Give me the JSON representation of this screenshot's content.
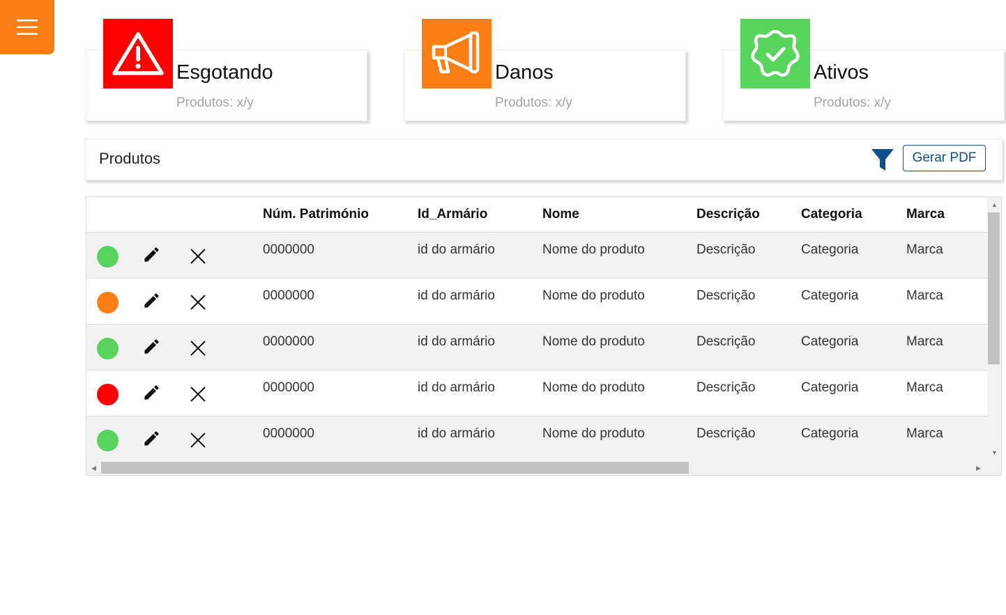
{
  "menu": {
    "icon": "hamburger-icon"
  },
  "cards": [
    {
      "title": "Esgotando",
      "subtitle": "Produtos: x/y",
      "icon": "warning-triangle-icon",
      "color": "#ff0000"
    },
    {
      "title": "Danos",
      "subtitle": "Produtos: x/y",
      "icon": "megaphone-icon",
      "color": "#fd7e14"
    },
    {
      "title": "Ativos",
      "subtitle": "Produtos: x/y",
      "icon": "verified-badge-icon",
      "color": "#56d45b"
    }
  ],
  "products": {
    "title": "Produtos",
    "filter_icon": "filter-funnel-icon",
    "pdf_button": "Gerar PDF"
  },
  "table": {
    "columns": [
      "Núm. Património",
      "Id_Armário",
      "Nome",
      "Descrição",
      "Categoria",
      "Marca"
    ],
    "rows": [
      {
        "status": "#56d45b",
        "num": "0000000",
        "armario": "id do armário",
        "nome": "Nome do produto",
        "descricao": "Descrição",
        "categoria": "Categoria",
        "marca": "Marca"
      },
      {
        "status": "#fd7e14",
        "num": "0000000",
        "armario": "id do armário",
        "nome": "Nome do produto",
        "descricao": "Descrição",
        "categoria": "Categoria",
        "marca": "Marca"
      },
      {
        "status": "#56d45b",
        "num": "0000000",
        "armario": "id do armário",
        "nome": "Nome do produto",
        "descricao": "Descrição",
        "categoria": "Categoria",
        "marca": "Marca"
      },
      {
        "status": "#ff0000",
        "num": "0000000",
        "armario": "id do armário",
        "nome": "Nome do produto",
        "descricao": "Descrição",
        "categoria": "Categoria",
        "marca": "Marca"
      },
      {
        "status": "#56d45b",
        "num": "0000000",
        "armario": "id do armário",
        "nome": "Nome do produto",
        "descricao": "Descrição",
        "categoria": "Categoria",
        "marca": "Marca"
      }
    ]
  }
}
